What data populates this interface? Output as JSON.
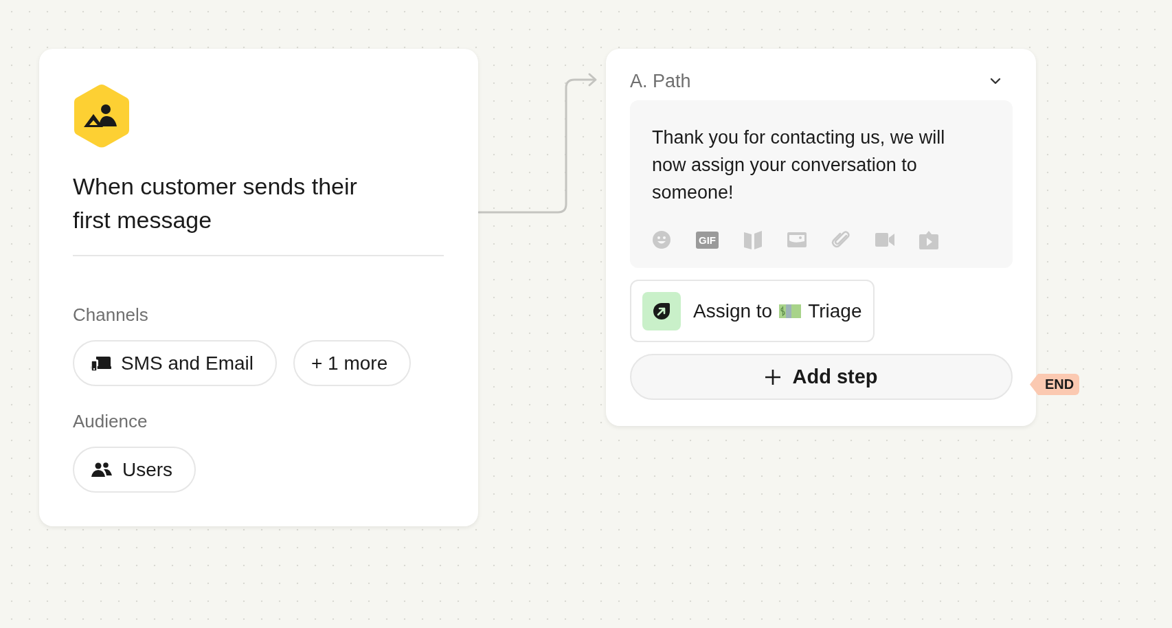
{
  "trigger": {
    "title": "When customer sends their first message",
    "sections": [
      {
        "label": "Channels",
        "chips": [
          {
            "kind": "channels",
            "label": "SMS and Email"
          },
          {
            "kind": "more",
            "label": "+ 1 more"
          }
        ]
      },
      {
        "label": "Audience",
        "chips": [
          {
            "kind": "users",
            "label": "Users"
          }
        ]
      }
    ]
  },
  "path": {
    "title": "A. Path",
    "expanded": true,
    "message": "Thank you for contacting us, we will now assign your conversation to someone!",
    "toolbar": [
      {
        "kind": "emoji"
      },
      {
        "kind": "gif",
        "label": "GIF"
      },
      {
        "kind": "article"
      },
      {
        "kind": "image"
      },
      {
        "kind": "attachment"
      },
      {
        "kind": "video"
      },
      {
        "kind": "app"
      }
    ],
    "action": {
      "label": "Assign to",
      "team": "Triage"
    },
    "add_step": "Add step"
  },
  "end_tag": "END"
}
